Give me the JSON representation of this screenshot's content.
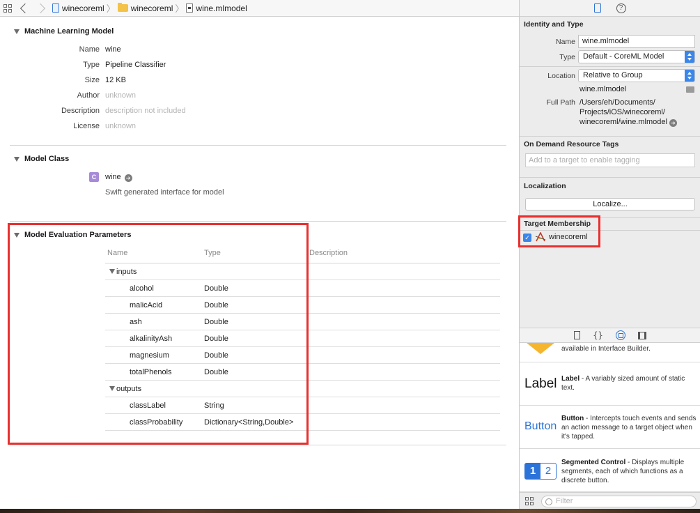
{
  "breadcrumb": {
    "project": "winecoreml",
    "group": "winecoreml",
    "file": "wine.mlmodel"
  },
  "ml_model": {
    "section_title": "Machine Learning Model",
    "fields": [
      {
        "label": "Name",
        "value": "wine",
        "muted": false
      },
      {
        "label": "Type",
        "value": "Pipeline Classifier",
        "muted": false
      },
      {
        "label": "Size",
        "value": "12 KB",
        "muted": false
      },
      {
        "label": "Author",
        "value": "unknown",
        "muted": true
      },
      {
        "label": "Description",
        "value": "description not included",
        "muted": true
      },
      {
        "label": "License",
        "value": "unknown",
        "muted": true
      }
    ]
  },
  "model_class": {
    "section_title": "Model Class",
    "icon_letter": "C",
    "class_name": "wine",
    "note": "Swift generated interface for model"
  },
  "eval_params": {
    "section_title": "Model Evaluation Parameters",
    "columns": {
      "name": "Name",
      "type": "Type",
      "description": "Description"
    },
    "inputs_label": "inputs",
    "inputs": [
      {
        "name": "alcohol",
        "type": "Double"
      },
      {
        "name": "malicAcid",
        "type": "Double"
      },
      {
        "name": "ash",
        "type": "Double"
      },
      {
        "name": "alkalinityAsh",
        "type": "Double"
      },
      {
        "name": "magnesium",
        "type": "Double"
      },
      {
        "name": "totalPhenols",
        "type": "Double"
      }
    ],
    "outputs_label": "outputs",
    "outputs": [
      {
        "name": "classLabel",
        "type": "String"
      },
      {
        "name": "classProbability",
        "type": "Dictionary<String,Double>"
      }
    ]
  },
  "inspector": {
    "identity": {
      "title": "Identity and Type",
      "name_label": "Name",
      "name_value": "wine.mlmodel",
      "type_label": "Type",
      "type_value": "Default - CoreML Model",
      "location_label": "Location",
      "location_value": "Relative to Group",
      "location_file": "wine.mlmodel",
      "fullpath_label": "Full Path",
      "fullpath_lines": [
        "/Users/eh/Documents/",
        "Projects/iOS/winecoreml/",
        "winecoreml/wine.mlmodel"
      ]
    },
    "odr": {
      "title": "On Demand Resource Tags",
      "placeholder": "Add to a target to enable tagging"
    },
    "localization": {
      "title": "Localization",
      "button": "Localize..."
    },
    "target_membership": {
      "title": "Target Membership",
      "target": "winecoreml",
      "checked": true
    }
  },
  "library": {
    "partial_text": "available in Interface Builder.",
    "items": [
      {
        "preview": "Label",
        "title": "Label",
        "desc": " - A variably sized amount of static text."
      },
      {
        "preview": "Button",
        "title": "Button",
        "desc": " - Intercepts touch events and sends an action message to a target object when it's tapped."
      },
      {
        "preview_segments": [
          "1",
          "2"
        ],
        "title": "Segmented Control",
        "desc": " - Displays multiple segments, each of which functions as a discrete button."
      }
    ],
    "filter_placeholder": "Filter"
  },
  "colors": {
    "accent": "#3b86ea",
    "highlight": "#e8302e"
  }
}
